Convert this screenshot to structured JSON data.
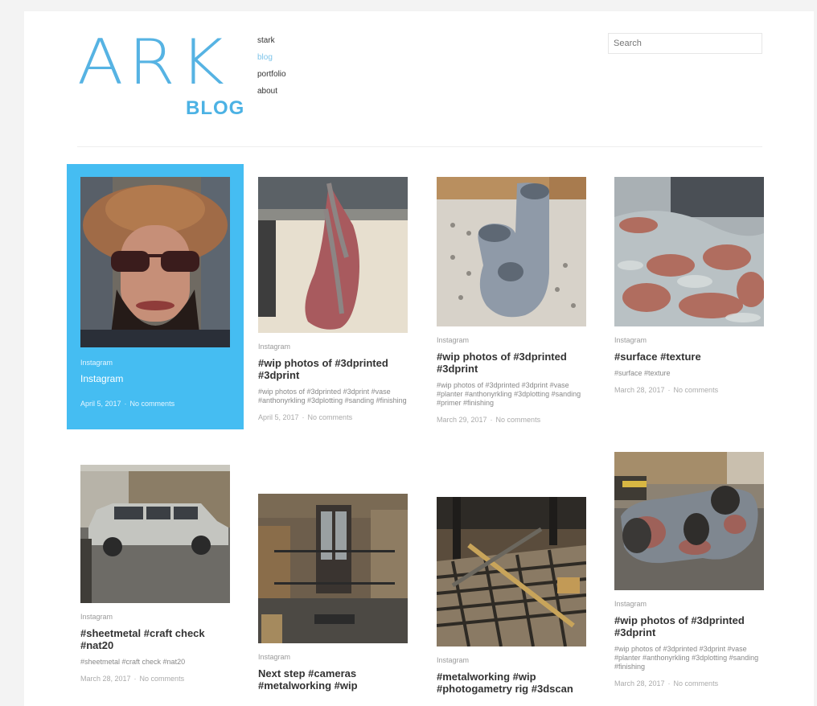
{
  "header": {
    "logo_text": "ARK",
    "logo_subtext": "BLOG",
    "nav": [
      "stark",
      "blog",
      "portfolio",
      "about"
    ],
    "nav_active": "blog",
    "search_placeholder": "Search"
  },
  "posts": [
    {
      "category": "Instagram",
      "title": "Instagram",
      "excerpt": "",
      "date": "April 5, 2017",
      "comments": "No comments",
      "image": "selfie"
    },
    {
      "category": "Instagram",
      "title": "#wip photos of #3dprinted #3dprint",
      "excerpt": "#wip photos of #3dprinted #3dprint #vase #anthonyrkling #3dplotting #sanding #finishing",
      "date": "April 5, 2017",
      "comments": "No comments",
      "image": "twisted-vase"
    },
    {
      "category": "Instagram",
      "title": "#wip photos of #3dprinted #3dprint",
      "excerpt": "#wip photos of #3dprinted #3dprint #vase #planter #anthonyrkling #3dplotting #sanding #primer #finishing",
      "date": "March 29, 2017",
      "comments": "No comments",
      "image": "grey-planter"
    },
    {
      "category": "Instagram",
      "title": "#surface #texture",
      "excerpt": "#surface #texture",
      "date": "March 28, 2017",
      "comments": "No comments",
      "image": "texture-closeup"
    },
    {
      "category": "Instagram",
      "title": "#sheetmetal #craft check #nat20",
      "excerpt": "#sheetmetal #craft check #nat20",
      "date": "March 28, 2017",
      "comments": "No comments",
      "image": "suv"
    },
    {
      "category": "Instagram",
      "title": "Next step #cameras #metalworking #wip",
      "excerpt": "",
      "date": "",
      "comments": "",
      "image": "workshop"
    },
    {
      "category": "Instagram",
      "title": "#metalworking #wip #photogametry rig #3dscan",
      "excerpt": "",
      "date": "",
      "comments": "",
      "image": "metal-rig"
    },
    {
      "category": "Instagram",
      "title": "#wip photos of #3dprinted #3dprint",
      "excerpt": "#wip photos of #3dprinted #3dprint #vase #planter #anthonyrkling #3dplotting #sanding #finishing",
      "date": "March 28, 2017",
      "comments": "No comments",
      "image": "planter-primer"
    }
  ]
}
